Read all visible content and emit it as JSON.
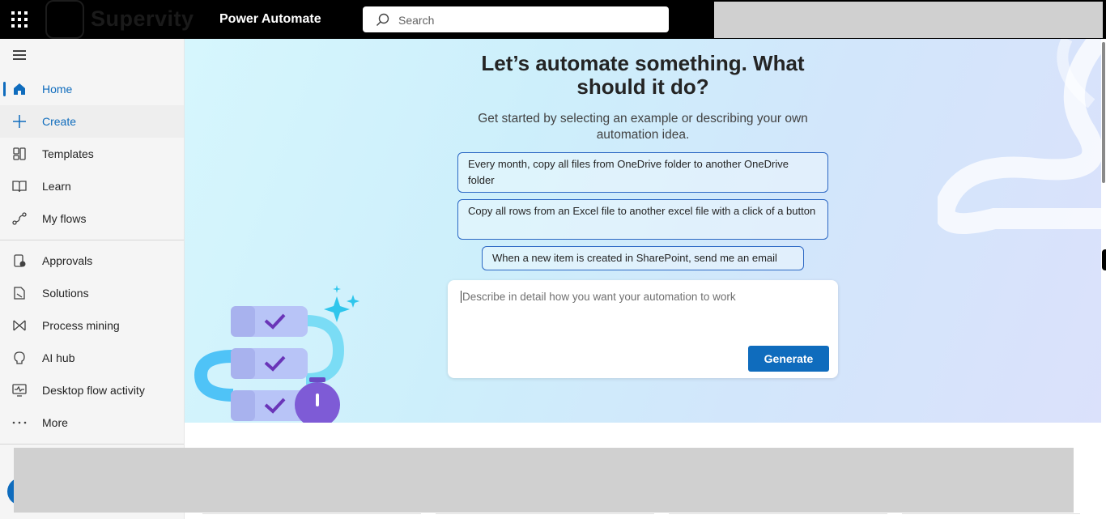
{
  "header": {
    "brand": "Supervity",
    "app_name": "Power Automate",
    "search_placeholder": "Search"
  },
  "sidebar": {
    "items": [
      {
        "label": "Home",
        "icon": "home-icon",
        "active": true
      },
      {
        "label": "Create",
        "icon": "plus-icon"
      },
      {
        "label": "Templates",
        "icon": "templates-icon"
      },
      {
        "label": "Learn",
        "icon": "book-icon"
      },
      {
        "label": "My flows",
        "icon": "flows-icon"
      },
      {
        "label": "Approvals",
        "icon": "approvals-icon"
      },
      {
        "label": "Solutions",
        "icon": "solutions-icon"
      },
      {
        "label": "Process mining",
        "icon": "process-mining-icon"
      },
      {
        "label": "AI hub",
        "icon": "ai-hub-icon"
      },
      {
        "label": "Desktop flow activity",
        "icon": "desktop-activity-icon"
      },
      {
        "label": "More",
        "icon": "more-icon"
      }
    ]
  },
  "hero": {
    "title_line1": "Let’s automate something. What",
    "title_line2": "should it do?",
    "subtitle": "Get started by selecting an example or describing your own automation idea.",
    "suggestions": [
      "Every month, copy all files from OneDrive folder to another OneDrive folder",
      "Copy all rows from an Excel file to another excel file with a click of a button",
      "When a new item is created in SharePoint, send me an email"
    ],
    "prompt_placeholder": "Describe in detail how you want your automation to work",
    "generate_label": "Generate"
  },
  "colors": {
    "accent": "#0f6cbd",
    "topbar": "#000000",
    "sidebar_bg": "#f5f5f5"
  }
}
